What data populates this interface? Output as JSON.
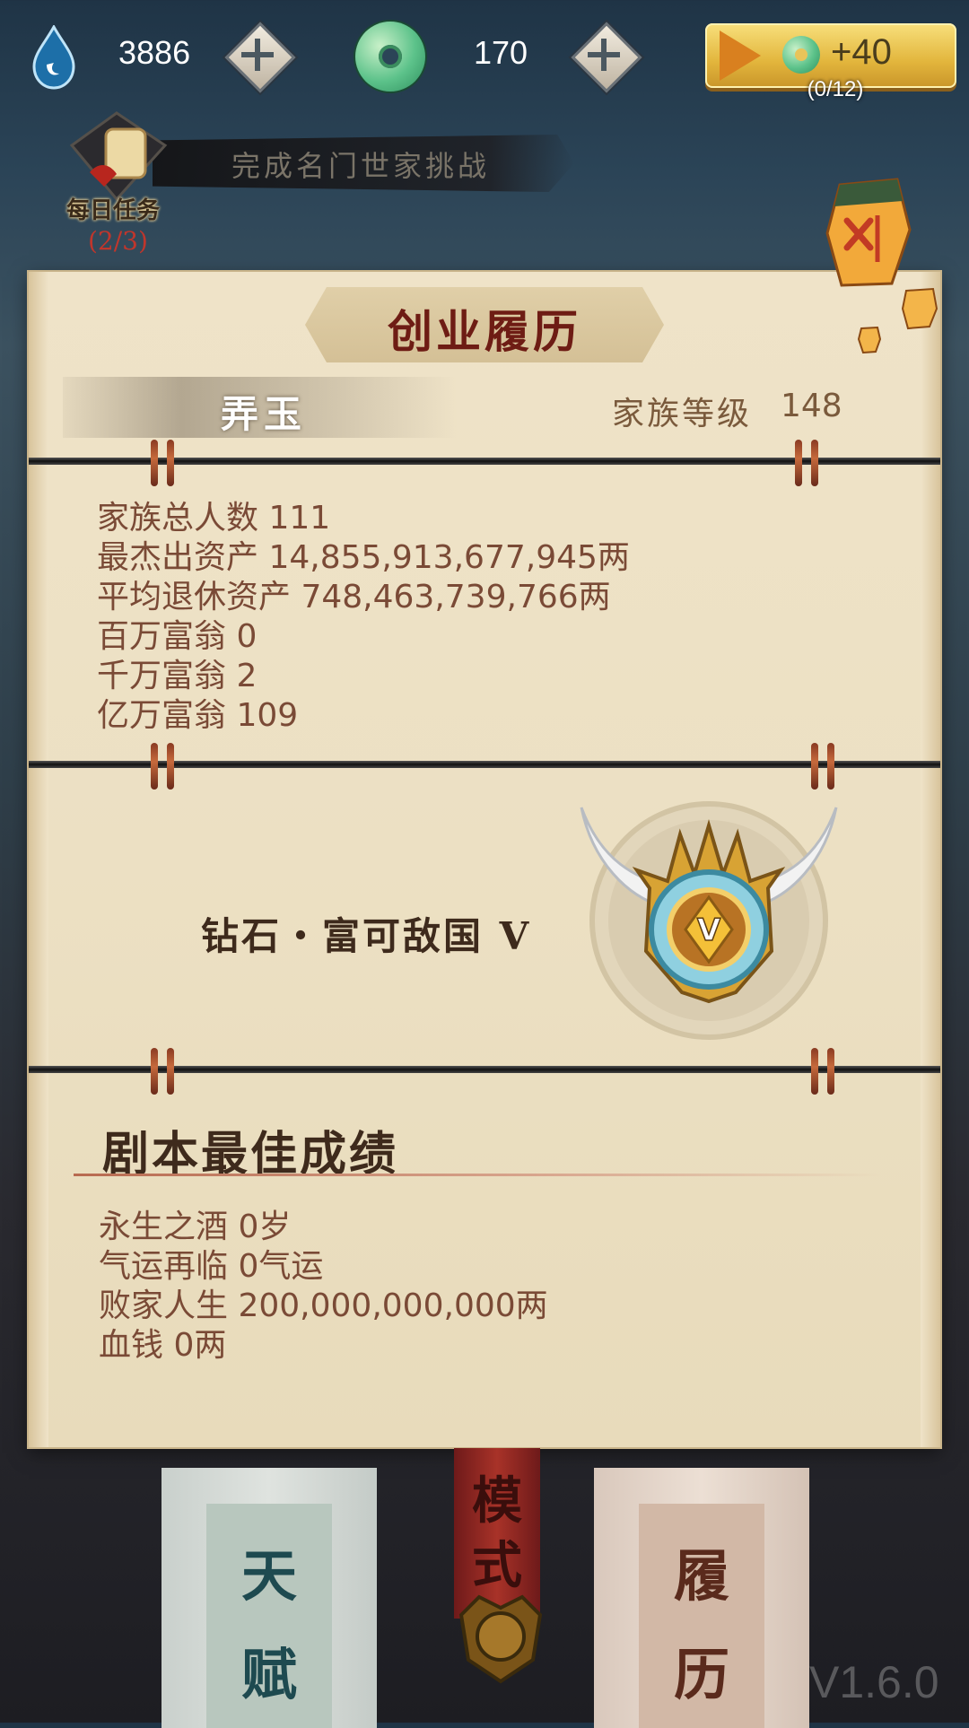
{
  "resources": {
    "drops": "3886",
    "jade": "170",
    "ad_reward": "+40",
    "ad_count": "(0/12)"
  },
  "daily_task": {
    "banner": "完成名门世家挑战",
    "label": "每日任务",
    "progress": "(2/3)"
  },
  "panel": {
    "title": "创业履历",
    "name": "弄玉",
    "level_label": "家族等级",
    "level_value": "148",
    "stats": [
      {
        "label": "家族总人数",
        "value": "111"
      },
      {
        "label": "最杰出资产",
        "value": "14,855,913,677,945两"
      },
      {
        "label": "平均退休资产",
        "value": "748,463,739,766两"
      },
      {
        "label": "百万富翁",
        "value": "0"
      },
      {
        "label": "千万富翁",
        "value": "2"
      },
      {
        "label": "亿万富翁",
        "value": "109"
      }
    ],
    "rank": "钻石・富可敌国 V",
    "badge_letter": "V",
    "best_title": "剧本最佳成绩",
    "best": [
      {
        "label": "永生之酒",
        "value": "0岁"
      },
      {
        "label": "气运再临",
        "value": "0气运"
      },
      {
        "label": "败家人生",
        "value": "200,000,000,000两"
      },
      {
        "label": "血钱",
        "value": "0两"
      }
    ]
  },
  "bottom": {
    "talent": [
      "天",
      "赋"
    ],
    "history": [
      "履",
      "历"
    ],
    "mode": [
      "模",
      "式"
    ],
    "version": "V1.6.0"
  },
  "colors": {
    "panel_bg": "#ece0c3",
    "title_red": "#6e1c14",
    "stat_text": "#7a4a36",
    "accent_gold": "#e2b53c"
  }
}
